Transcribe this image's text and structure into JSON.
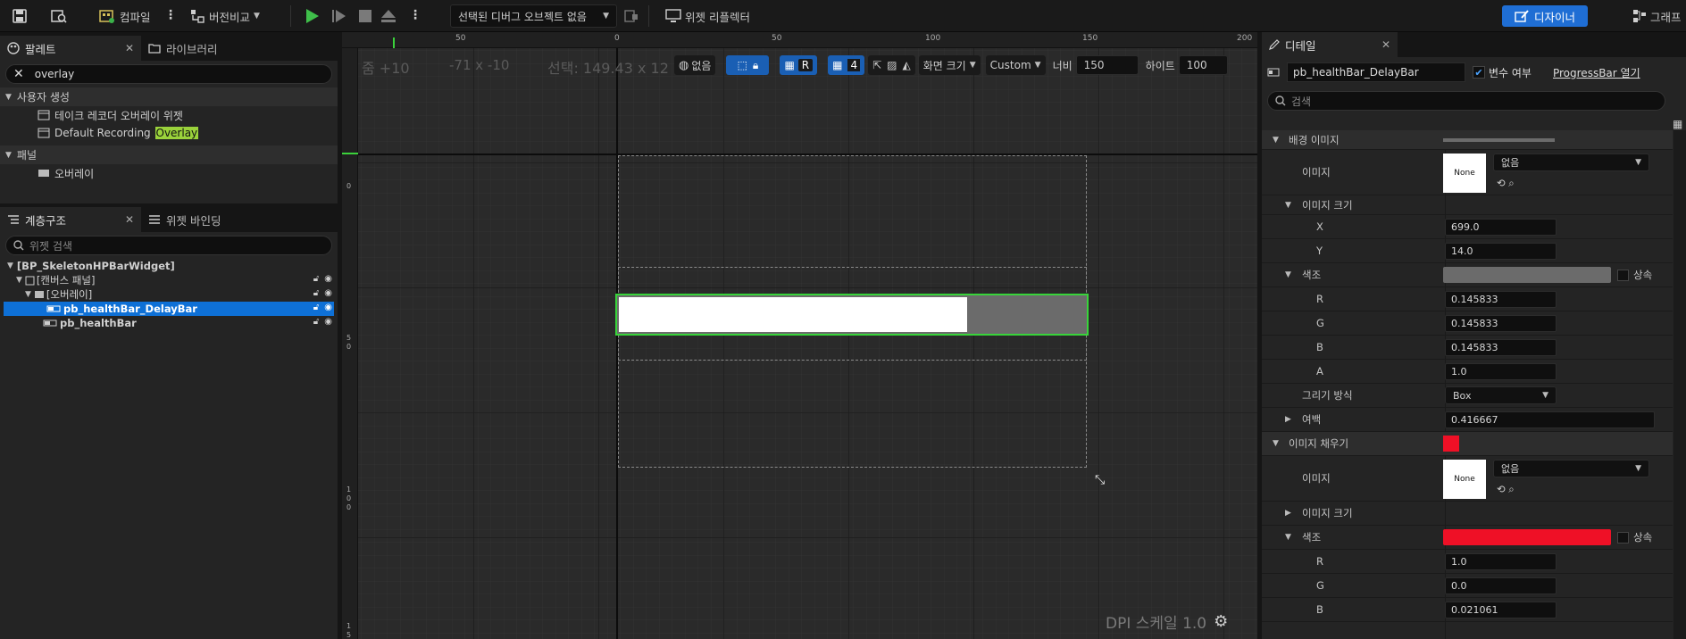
{
  "toolbar": {
    "compile_label": "컴파일",
    "diff_label": "버전비교",
    "debug_object_label": "선택된 디버그 오브젝트 없음",
    "widget_reflector_label": "위젯 리플렉터",
    "designer_label": "디자이너",
    "graph_label": "그래프"
  },
  "palette": {
    "tab_palette": "팔레트",
    "tab_library": "라이브러리",
    "search_value": "overlay",
    "category_user": "사용자 생성",
    "items_user": [
      "테이크 레코더 오버레이 위젯",
      "Default Recording "
    ],
    "highlight": "Overlay",
    "category_panel": "패널",
    "items_panel": [
      "오버레이"
    ]
  },
  "hierarchy": {
    "tab_hierarchy": "계층구조",
    "tab_bindings": "위젯 바인딩",
    "search_placeholder": "위젯 검색",
    "root": "[BP_SkeletonHPBarWidget]",
    "canvas": "[캔버스 패널]",
    "overlay": "[오버레이]",
    "delay_bar": "pb_healthBar_DelayBar",
    "health_bar": "pb_healthBar"
  },
  "viewport": {
    "zoom": "줌 +10",
    "coords": "-71 x -10",
    "selection": "선택: 149.43 x 12",
    "locale": "없음",
    "r_label": "R",
    "grid_snap": "4",
    "screen_size": "화면 크기",
    "custom": "Custom",
    "width_label": "너비",
    "width_value": "150",
    "height_label": "하이트",
    "height_value": "100",
    "dpi": "DPI 스케일 1.0",
    "ruler_top": [
      "50",
      "0",
      "50",
      "100",
      "150",
      "200"
    ],
    "ruler_left": [
      "0",
      "5",
      "0",
      "1",
      "0",
      "0",
      "1",
      "5"
    ],
    "progress_fill_fraction": 0.745
  },
  "details": {
    "tab": "디테일",
    "widget_name": "pb_healthBar_DelayBar",
    "is_variable_label": "변수 여부",
    "open_label": "ProgressBar 열기",
    "search_placeholder": "검색",
    "bg_image_section": "배경 이미지",
    "image_label": "이미지",
    "none_thumb": "None",
    "none_value": "없음",
    "image_size_label": "이미지 크기",
    "x_label": "X",
    "x_value": "699.0",
    "y_label": "Y",
    "y_value": "14.0",
    "tint_label": "색조",
    "inherit_label": "상속",
    "r_label": "R",
    "r_value": "0.145833",
    "g_label": "G",
    "g_value": "0.145833",
    "b_label": "B",
    "b_value": "0.145833",
    "a_label": "A",
    "a_value": "1.0",
    "draw_as_label": "그리기 방식",
    "draw_as_value": "Box",
    "margin_label": "여백",
    "margin_value": "0.416667",
    "fill_image_section": "이미지 채우기",
    "fill_r_value": "1.0",
    "fill_g_value": "0.0",
    "fill_b_value": "0.021061",
    "colors": {
      "bg_tint": "#6b6b6b",
      "fill_tint": "#ef1026",
      "accent": "#1f6ed4"
    }
  }
}
